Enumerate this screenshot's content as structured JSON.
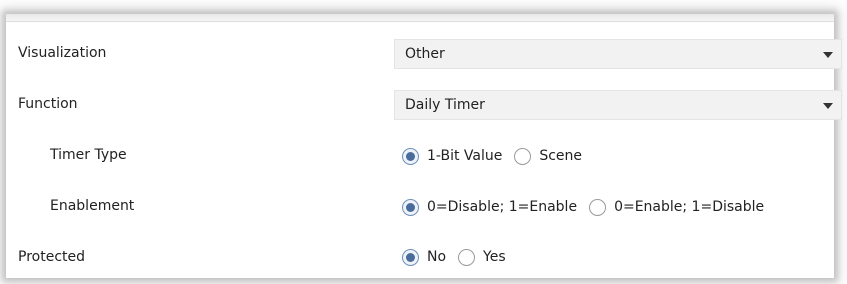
{
  "fields": {
    "visualization": {
      "label": "Visualization",
      "value": "Other"
    },
    "function": {
      "label": "Function",
      "value": "Daily Timer"
    },
    "timer_type": {
      "label": "Timer Type",
      "options": [
        "1-Bit Value",
        "Scene"
      ],
      "selected": "1-Bit Value"
    },
    "enablement": {
      "label": "Enablement",
      "options": [
        "0=Disable; 1=Enable",
        "0=Enable; 1=Disable"
      ],
      "selected": "0=Disable; 1=Enable"
    },
    "protected": {
      "label": "Protected",
      "options": [
        "No",
        "Yes"
      ],
      "selected": "No"
    }
  },
  "colors": {
    "radio_selected": "#4a6c9b",
    "dropdown_bg": "#f2f2f2"
  }
}
